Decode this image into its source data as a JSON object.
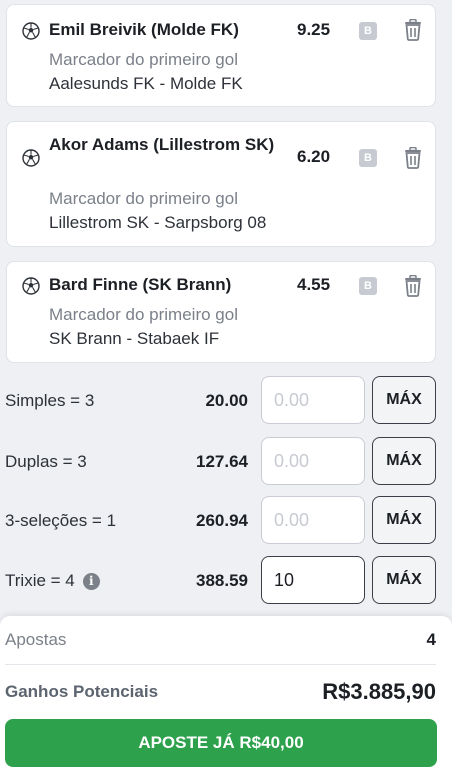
{
  "selections": [
    {
      "player": "Emil Breivik (Molde FK)",
      "odds": "9.25",
      "badge": "B",
      "market": "Marcador do primeiro gol",
      "match": "Aalesunds FK - Molde FK",
      "icon": "soccer-ball-icon"
    },
    {
      "player": "Akor Adams (Lillestrom SK)",
      "odds": "6.20",
      "badge": "B",
      "market": "Marcador do primeiro gol",
      "match": "Lillestrom SK - Sarpsborg 08",
      "icon": "soccer-ball-icon"
    },
    {
      "player": "Bard Finne (SK Brann)",
      "odds": "4.55",
      "badge": "B",
      "market": "Marcador do primeiro gol",
      "match": "SK Brann - Stabaek IF",
      "icon": "soccer-ball-icon"
    }
  ],
  "systems": [
    {
      "label": "Simples = 3",
      "value": "20.00",
      "stake": "",
      "placeholder": "0.00",
      "max_label": "MÁX"
    },
    {
      "label": "Duplas = 3",
      "value": "127.64",
      "stake": "",
      "placeholder": "0.00",
      "max_label": "MÁX"
    },
    {
      "label": "3-seleções = 1",
      "value": "260.94",
      "stake": "",
      "placeholder": "0.00",
      "max_label": "MÁX"
    },
    {
      "label": "Trixie = 4",
      "value": "388.59",
      "stake": "10",
      "placeholder": "0.00",
      "max_label": "MÁX",
      "has_info": true,
      "info_glyph": "i"
    }
  ],
  "summary": {
    "apostas_label": "Apostas",
    "apostas_value": "4",
    "ganhos_label": "Ganhos Potenciais",
    "ganhos_value": "R$3.885,90",
    "cta_label": "APOSTE JÁ R$40,00"
  },
  "colors": {
    "accent_green": "#2ea14d",
    "muted_text": "#7b8089",
    "badge_gray": "#c7cbd1"
  }
}
